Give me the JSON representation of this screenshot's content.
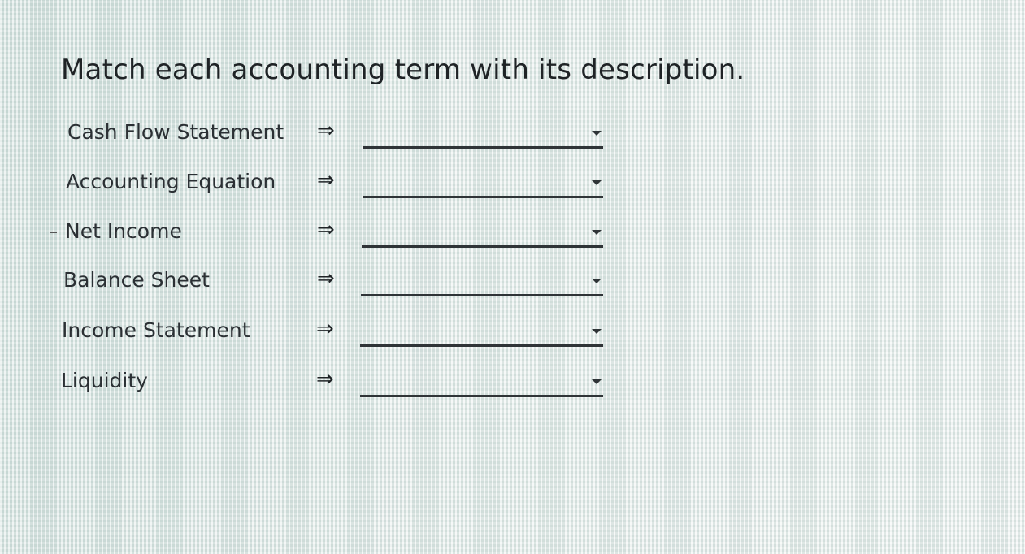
{
  "prompt": "Match each accounting term with its description.",
  "arrow_symbol": "⇒",
  "rows": [
    {
      "term": "Cash Flow Statement",
      "selected": ""
    },
    {
      "term": "Accounting Equation",
      "selected": ""
    },
    {
      "term": "Net Income",
      "selected": ""
    },
    {
      "term": "Balance Sheet",
      "selected": ""
    },
    {
      "term": "Income Statement",
      "selected": ""
    },
    {
      "term": "Liquidity",
      "selected": ""
    }
  ],
  "colors": {
    "background": "#e7ecea",
    "text": "#2a2f33",
    "underline": "#2f3437"
  },
  "icons": {
    "arrow": "double-right-arrow-icon",
    "dropdown": "chevron-down-icon"
  }
}
